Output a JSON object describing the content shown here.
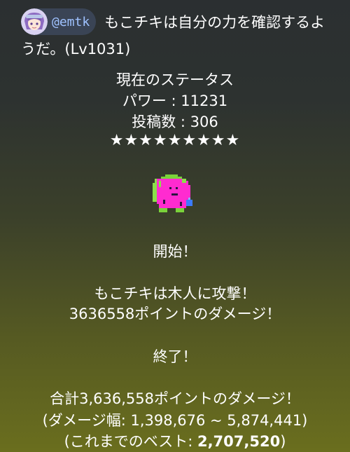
{
  "post": {
    "mention": "@emtk",
    "line1": "もこチキは自分の力を確認するよ",
    "line2": "うだ。(Lv1031)"
  },
  "status": {
    "title": "現在のステータス",
    "power": "パワー : 11231",
    "posts": "投稿数 : 306",
    "stars": "★★★★★★★★★"
  },
  "battle": {
    "start": "開始！",
    "attack": "もこチキは木人に攻撃！",
    "damage": "3636558ポイントのダメージ！",
    "end": "終了！",
    "total": "合計3,636,558ポイントのダメージ！",
    "range": "(ダメージ幅: 1,398,676 ~ 5,874,441)",
    "best_prefix": "(これまでのベスト: ",
    "best_value": "2,707,520",
    "best_suffix": ")"
  },
  "icons": {
    "avatar": "avatar-girl-icon",
    "sprite": "pixel-monster-sprite"
  }
}
